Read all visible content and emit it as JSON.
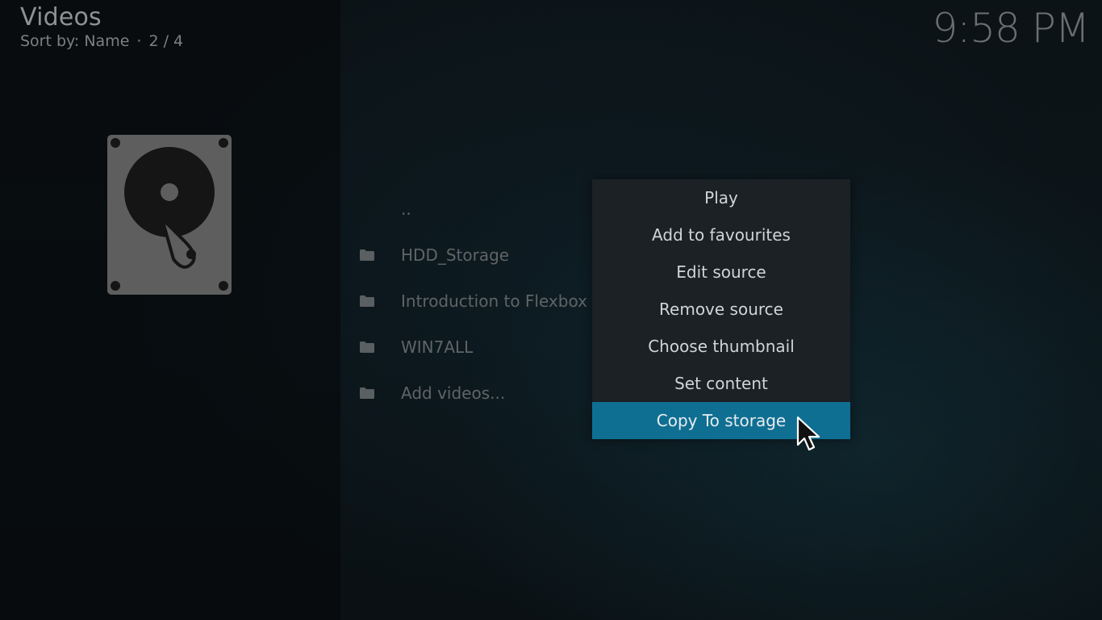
{
  "header": {
    "title": "Videos",
    "sort_label": "Sort by: Name",
    "separator": "·",
    "position": "2 / 4"
  },
  "clock": "9:58 PM",
  "thumbnail": {
    "icon": "hard-drive-icon"
  },
  "file_list": {
    "items": [
      {
        "label": "..",
        "icon": ""
      },
      {
        "label": "HDD_Storage",
        "icon": "folder-icon"
      },
      {
        "label": "Introduction to Flexbox",
        "icon": "folder-icon"
      },
      {
        "label": "WIN7ALL",
        "icon": "folder-icon"
      },
      {
        "label": "Add videos...",
        "icon": "folder-icon"
      }
    ]
  },
  "context_menu": {
    "items": [
      {
        "label": "Play"
      },
      {
        "label": "Add to favourites"
      },
      {
        "label": "Edit source"
      },
      {
        "label": "Remove source"
      },
      {
        "label": "Choose thumbnail"
      },
      {
        "label": "Set content"
      },
      {
        "label": "Copy To storage",
        "focused": true
      }
    ]
  },
  "colors": {
    "focus_highlight": "#0f6f93",
    "menu_background": "#1b2125"
  }
}
